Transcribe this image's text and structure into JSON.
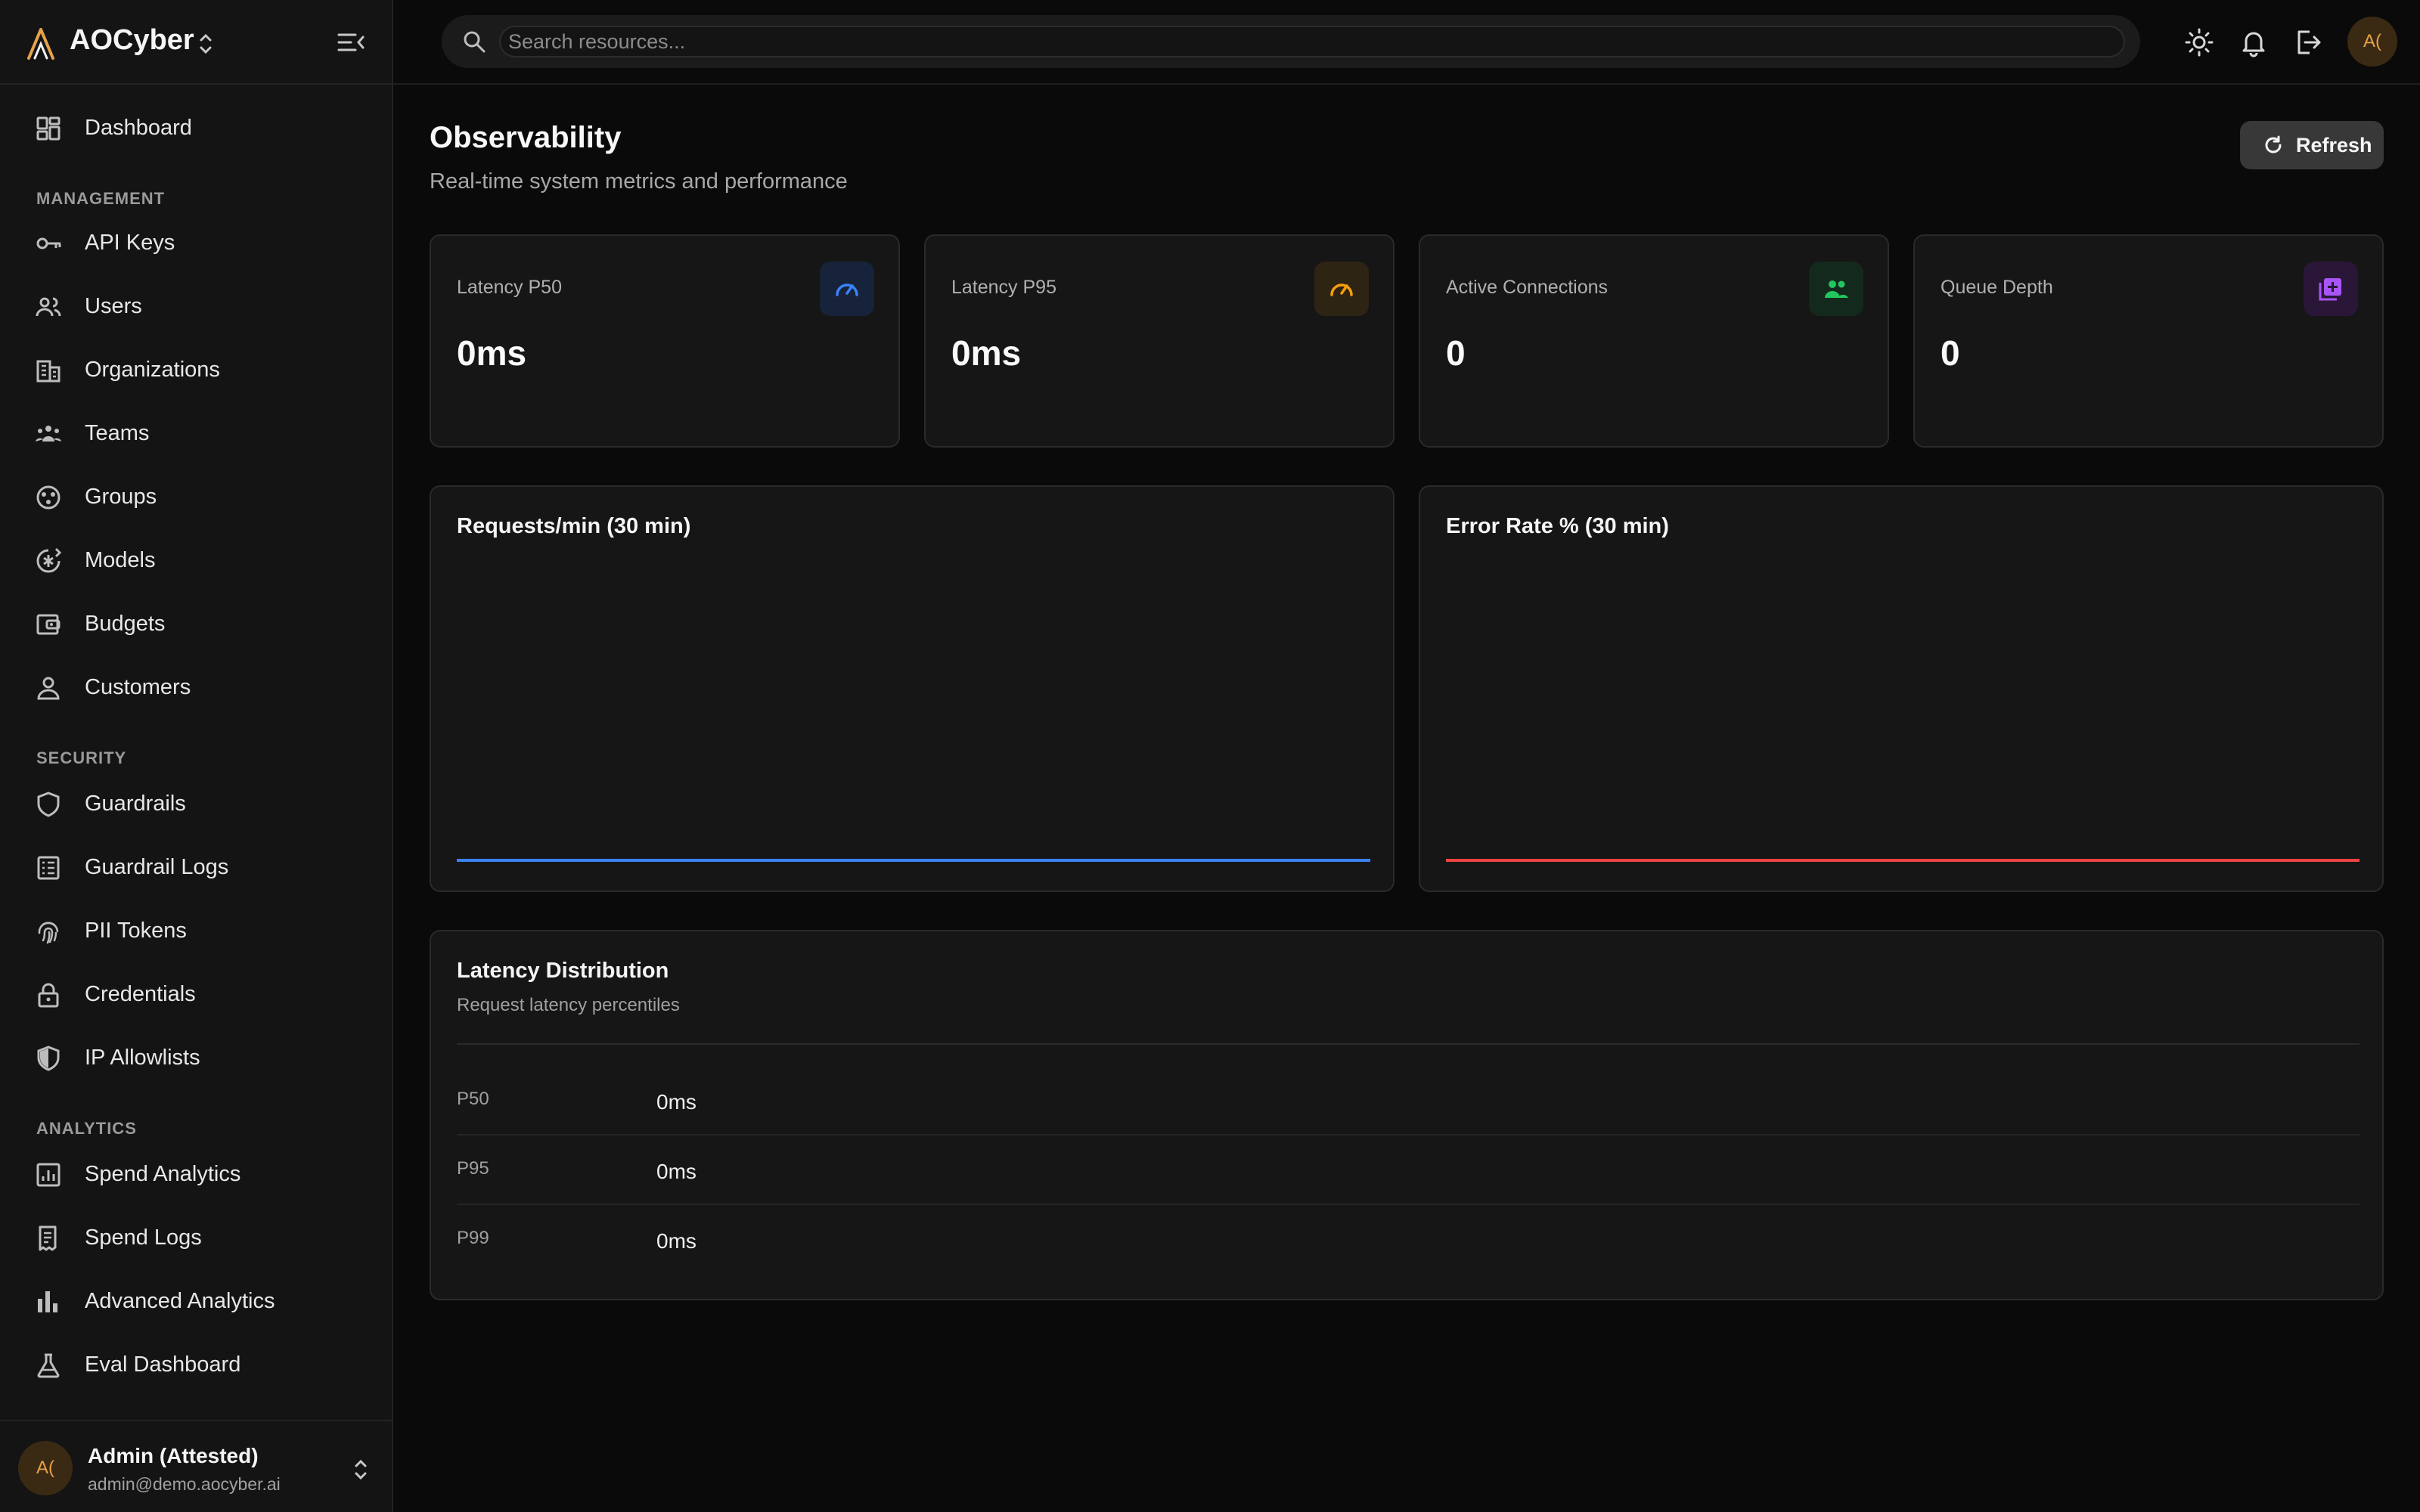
{
  "brand": {
    "name": "AOCyber"
  },
  "search": {
    "placeholder": "Search resources..."
  },
  "nav": {
    "dashboard": "Dashboard",
    "sections": {
      "management": "MANAGEMENT",
      "security": "SECURITY",
      "analytics": "ANALYTICS"
    },
    "items": [
      {
        "label": "API Keys",
        "icon": "key-icon"
      },
      {
        "label": "Users",
        "icon": "users-icon"
      },
      {
        "label": "Organizations",
        "icon": "building-icon"
      },
      {
        "label": "Teams",
        "icon": "team-icon"
      },
      {
        "label": "Groups",
        "icon": "groups-icon"
      },
      {
        "label": "Models",
        "icon": "model-icon"
      },
      {
        "label": "Budgets",
        "icon": "wallet-icon"
      },
      {
        "label": "Customers",
        "icon": "person-icon"
      },
      {
        "label": "Guardrails",
        "icon": "shield-icon"
      },
      {
        "label": "Guardrail Logs",
        "icon": "log-icon"
      },
      {
        "label": "PII Tokens",
        "icon": "fingerprint-icon"
      },
      {
        "label": "Credentials",
        "icon": "lock-icon"
      },
      {
        "label": "IP Allowlists",
        "icon": "shield-half-icon"
      },
      {
        "label": "Spend Analytics",
        "icon": "analytics-icon"
      },
      {
        "label": "Spend Logs",
        "icon": "receipt-icon"
      },
      {
        "label": "Advanced Analytics",
        "icon": "bar-chart-icon"
      },
      {
        "label": "Eval Dashboard",
        "icon": "flask-icon"
      }
    ]
  },
  "user": {
    "initials": "A(",
    "name": "Admin (Attested)",
    "email": "admin@demo.aocyber.ai"
  },
  "page": {
    "title": "Observability",
    "subtitle": "Real-time system metrics and performance",
    "refresh_label": "Refresh"
  },
  "stats": [
    {
      "label": "Latency P50",
      "value": "0ms",
      "icon": "gauge-icon",
      "color": "#3b82f6"
    },
    {
      "label": "Latency P95",
      "value": "0ms",
      "icon": "gauge-icon",
      "color": "#f59e0b"
    },
    {
      "label": "Active Connections",
      "value": "0",
      "icon": "people-icon",
      "color": "#22c55e"
    },
    {
      "label": "Queue Depth",
      "value": "0",
      "icon": "queue-icon",
      "color": "#a855f7"
    }
  ],
  "charts": [
    {
      "title": "Requests/min (30 min)",
      "color": "#3b82f6"
    },
    {
      "title": "Error Rate % (30 min)",
      "color": "#ef4444"
    }
  ],
  "chart_data": [
    {
      "type": "line",
      "title": "Requests/min (30 min)",
      "series": [
        {
          "values": [
            0,
            0
          ]
        }
      ],
      "color": "#3b82f6"
    },
    {
      "type": "line",
      "title": "Error Rate % (30 min)",
      "series": [
        {
          "values": [
            0,
            0
          ]
        }
      ],
      "color": "#ef4444"
    }
  ],
  "distribution": {
    "title": "Latency Distribution",
    "subtitle": "Request latency percentiles",
    "rows": [
      {
        "key": "P50",
        "value": "0ms"
      },
      {
        "key": "P95",
        "value": "0ms"
      },
      {
        "key": "P99",
        "value": "0ms"
      }
    ]
  }
}
